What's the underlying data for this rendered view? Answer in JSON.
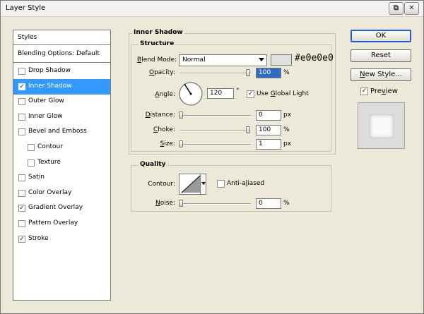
{
  "window": {
    "title": "Layer Style",
    "help_icon": "help-icon",
    "close_icon": "close-icon"
  },
  "styles_panel": {
    "header": "Styles",
    "blending_options": "Blending Options: Default",
    "items": [
      {
        "label": "Drop Shadow",
        "checked": false,
        "selected": false,
        "sub": false
      },
      {
        "label": "Inner Shadow",
        "checked": true,
        "selected": true,
        "sub": false
      },
      {
        "label": "Outer Glow",
        "checked": false,
        "selected": false,
        "sub": false
      },
      {
        "label": "Inner Glow",
        "checked": false,
        "selected": false,
        "sub": false
      },
      {
        "label": "Bevel and Emboss",
        "checked": false,
        "selected": false,
        "sub": false
      },
      {
        "label": "Contour",
        "checked": false,
        "selected": false,
        "sub": true
      },
      {
        "label": "Texture",
        "checked": false,
        "selected": false,
        "sub": true
      },
      {
        "label": "Satin",
        "checked": false,
        "selected": false,
        "sub": false
      },
      {
        "label": "Color Overlay",
        "checked": false,
        "selected": false,
        "sub": false
      },
      {
        "label": "Gradient Overlay",
        "checked": true,
        "selected": false,
        "sub": false
      },
      {
        "label": "Pattern Overlay",
        "checked": false,
        "selected": false,
        "sub": false
      },
      {
        "label": "Stroke",
        "checked": true,
        "selected": false,
        "sub": false
      }
    ]
  },
  "inner_shadow": {
    "section_title": "Inner Shadow",
    "structure_title": "Structure",
    "blend_mode_label": "Blend Mode:",
    "blend_mode_value": "Normal",
    "color_hex": "#e0e0e0",
    "opacity_label": "Opacity:",
    "opacity_value": "100",
    "opacity_unit": "%",
    "angle_label": "Angle:",
    "angle_value": "120",
    "angle_unit": "°",
    "use_global_light_label": "Use Global Light",
    "use_global_light_checked": true,
    "distance_label": "Distance:",
    "distance_value": "0",
    "distance_unit": "px",
    "choke_label": "Choke:",
    "choke_value": "100",
    "choke_unit": "%",
    "size_label": "Size:",
    "size_value": "1",
    "size_unit": "px",
    "quality_title": "Quality",
    "contour_label": "Contour:",
    "anti_aliased_label": "Anti-aliased",
    "anti_aliased_checked": false,
    "noise_label": "Noise:",
    "noise_value": "0",
    "noise_unit": "%"
  },
  "buttons": {
    "ok": "OK",
    "reset": "Reset",
    "new_style": "New Style...",
    "preview_label": "Preview",
    "preview_checked": true
  },
  "colors": {
    "dialog_bg": "#ece9d8",
    "selection_bg": "#3399ff",
    "shadow_color": "#e0e0e0",
    "default_button_border": "#2b57d0"
  }
}
